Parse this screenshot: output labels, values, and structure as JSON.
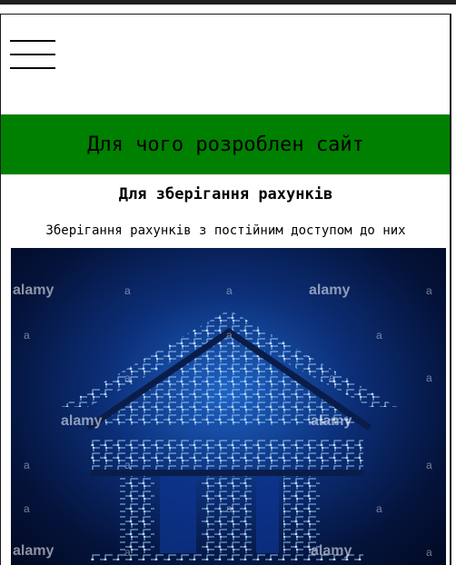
{
  "header": {
    "menu_icon": "hamburger-menu-icon"
  },
  "banner": {
    "title": "Для чого розроблен сайт",
    "background": "#008000"
  },
  "section": {
    "heading": "Для зберігання рахунків",
    "description": "Зберігання рахунків з постійним доступом до них"
  },
  "image": {
    "subject": "circuit-board-house-illustration",
    "watermark": "alamy",
    "watermark_mark": "a"
  }
}
